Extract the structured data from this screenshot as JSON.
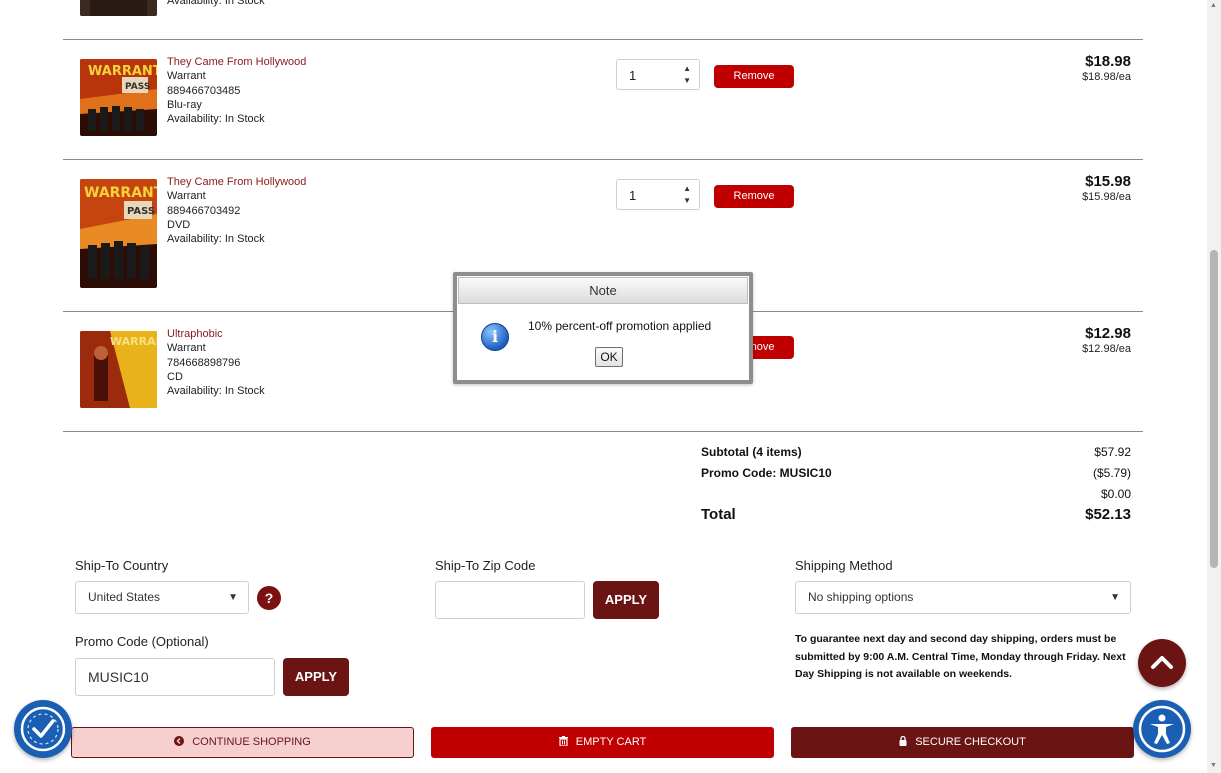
{
  "cart": {
    "items": [
      {
        "title": "They Came From Hollywood",
        "artist": "Warrant",
        "upc": "889466703485",
        "format": "Blu-ray",
        "availability": "Availability: In Stock",
        "qty": "1",
        "remove_label": "Remove",
        "price_total": "$18.98",
        "price_each": "$18.98/ea"
      },
      {
        "title": "They Came From Hollywood",
        "artist": "Warrant",
        "upc": "889466703492",
        "format": "DVD",
        "availability": "Availability: In Stock",
        "qty": "1",
        "remove_label": "Remove",
        "price_total": "$15.98",
        "price_each": "$15.98/ea"
      },
      {
        "title": "Ultraphobic",
        "artist": "Warrant",
        "upc": "784668898796",
        "format": "CD",
        "availability": "Availability: In Stock",
        "qty": "",
        "remove_label": "Remove",
        "price_total": "$12.98",
        "price_each": "$12.98/ea"
      }
    ],
    "partial_top_availability": "Availability: In Stock"
  },
  "summary": {
    "subtotal_label": "Subtotal (4 items)",
    "subtotal_value": "$57.92",
    "promo_label": "Promo Code: MUSIC10",
    "promo_value": "($5.79)",
    "shipping_value": "$0.00",
    "total_label": "Total",
    "total_value": "$52.13"
  },
  "form": {
    "country_label": "Ship-To Country",
    "country_value": "United States",
    "help_glyph": "?",
    "zip_label": "Ship-To Zip Code",
    "zip_value": "",
    "zip_apply": "APPLY",
    "shipping_method_label": "Shipping Method",
    "shipping_method_value": "No shipping options",
    "promo_label": "Promo Code (Optional)",
    "promo_value": "MUSIC10",
    "promo_apply": "APPLY",
    "shipping_note": "To guarantee next day and second day shipping, orders must be submitted by 9:00 A.M. Central Time, Monday through Friday. Next Day Shipping is not available on weekends."
  },
  "buttons": {
    "continue": "CONTINUE SHOPPING",
    "empty": "EMPTY CART",
    "secure": "SECURE CHECKOUT"
  },
  "dialog": {
    "title": "Note",
    "message": "10% percent-off promotion applied",
    "ok": "OK",
    "icon_glyph": "i"
  },
  "icons": [
    "chevron-left-circle-icon",
    "trash-icon",
    "lock-icon",
    "chevron-up-icon",
    "accessibility-icon",
    "accessibility-check-icon",
    "info-icon",
    "help-icon"
  ],
  "colors": {
    "brand_maroon": "#6b1414",
    "remove_red": "#c00000",
    "accessibility_blue": "#1a5fb4",
    "title_link": "#8a1a1a"
  }
}
